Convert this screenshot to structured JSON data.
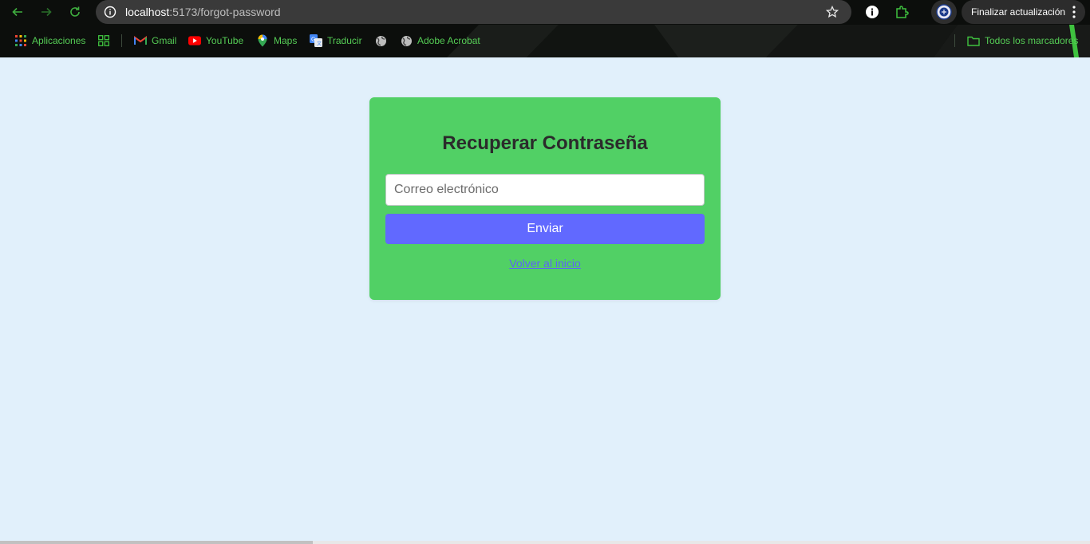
{
  "browser": {
    "url_host": "localhost",
    "url_path": ":5173/forgot-password",
    "update_label": "Finalizar actualización",
    "icons": {
      "back": "arrow-left-icon",
      "forward": "arrow-right-icon",
      "reload": "reload-icon",
      "site_info": "info-icon",
      "bookmark_star": "star-icon",
      "extension_info": "info-circle-icon",
      "extensions": "puzzle-icon",
      "profile": "profile-crest-icon",
      "menu": "more-vertical-icon"
    },
    "bookmarks": [
      {
        "label": "Aplicaciones",
        "icon": "apps-grid-icon"
      },
      {
        "label": "",
        "icon": "tab-groups-icon"
      },
      {
        "label": "Gmail",
        "icon": "gmail-icon"
      },
      {
        "label": "YouTube",
        "icon": "youtube-icon"
      },
      {
        "label": "Maps",
        "icon": "maps-pin-icon"
      },
      {
        "label": "Traducir",
        "icon": "translate-icon"
      },
      {
        "label": "",
        "icon": "globe-icon"
      },
      {
        "label": "Adobe Acrobat",
        "icon": "globe-icon"
      }
    ],
    "all_bookmarks_label": "Todos los marcadores",
    "accent_color": "#55cc55"
  },
  "page": {
    "title": "Recuperar Contraseña",
    "email_placeholder": "Correo electrónico",
    "email_value": "",
    "submit_label": "Enviar",
    "back_link_label": "Volver al inicio",
    "colors": {
      "background": "#e1f0fb",
      "card": "#51d065",
      "button": "#6169ff",
      "link": "#5d65f5"
    }
  }
}
